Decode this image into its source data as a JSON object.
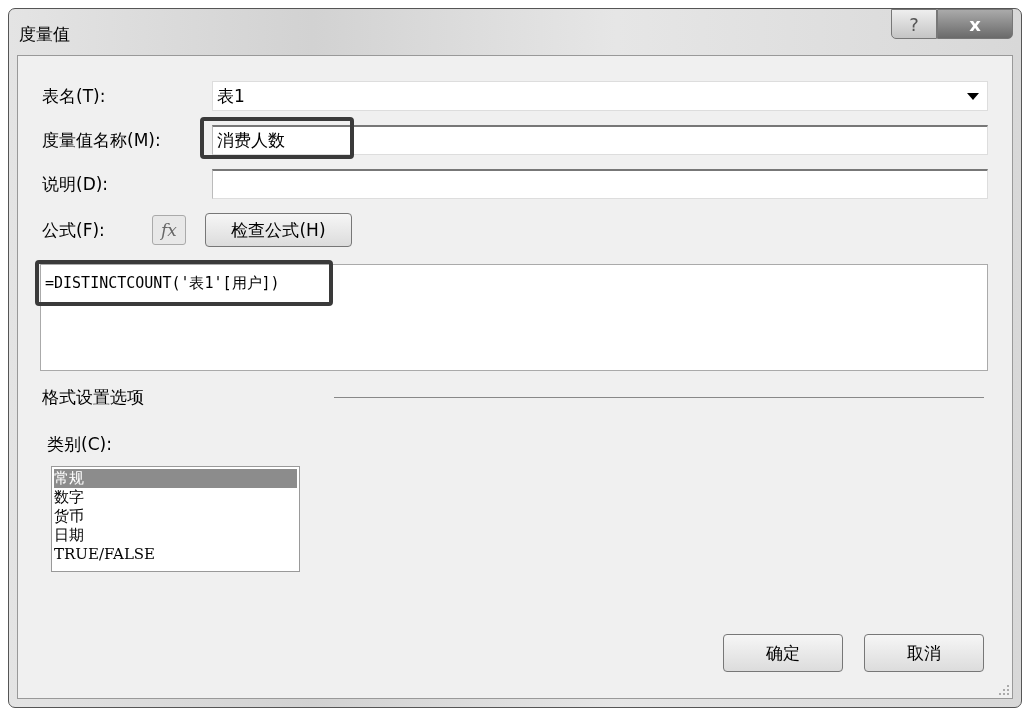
{
  "window": {
    "title": "度量值",
    "help_button": "?",
    "close_button": "x"
  },
  "fields": [
    {
      "kind": "dropdown",
      "label": "表名(T):",
      "value": "表1",
      "highlighted": false
    },
    {
      "kind": "text",
      "label": "度量值名称(M):",
      "value": "消费人数",
      "highlighted": true
    },
    {
      "kind": "text",
      "label": "说明(D):",
      "highlighted": false
    }
  ],
  "formula": {
    "label": "公式(F):",
    "fx_button": "fx",
    "check_button": "检查公式(H)",
    "value": "=DISTINCTCOUNT('表1'[用户])",
    "highlighted": true
  },
  "format_section": {
    "title": "格式设置选项",
    "category_label": "类别(C):",
    "categories": [
      {
        "label": "常规",
        "selected": true
      },
      {
        "label": "数字",
        "selected": false
      },
      {
        "label": "货币",
        "selected": false
      },
      {
        "label": "日期",
        "selected": false
      },
      {
        "label": "TRUE/FALSE",
        "selected": false
      }
    ]
  },
  "buttons": [
    "确定",
    "取消"
  ]
}
